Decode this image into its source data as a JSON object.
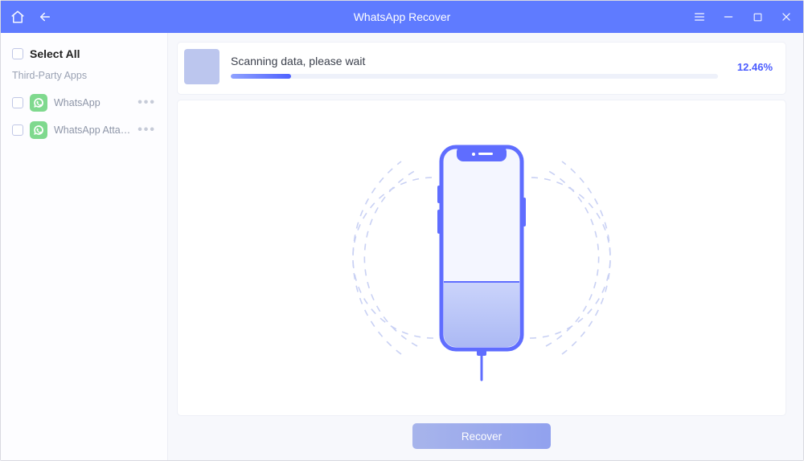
{
  "titlebar": {
    "title": "WhatsApp Recover"
  },
  "sidebar": {
    "select_all_label": "Select All",
    "group_label": "Third-Party Apps",
    "items": [
      {
        "label": "WhatsApp"
      },
      {
        "label": "WhatsApp Attachments"
      }
    ]
  },
  "progress": {
    "status_text": "Scanning data, please wait",
    "percent_label": "12.46%",
    "percent_value": 12.46
  },
  "footer": {
    "recover_label": "Recover"
  },
  "colors": {
    "brand": "#5f7bff",
    "accent": "#4b5cff",
    "whatsapp_green": "#7fd98e"
  }
}
